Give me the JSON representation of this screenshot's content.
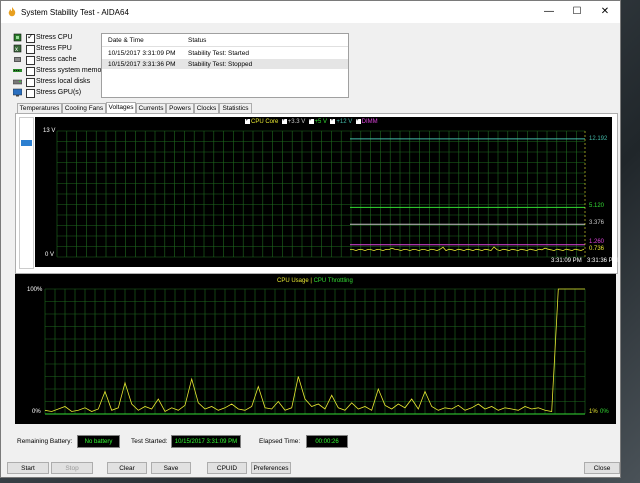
{
  "window": {
    "title": "System Stability Test - AIDA64",
    "controls": {
      "minimize": "—",
      "maximize": "☐",
      "close": "✕"
    }
  },
  "stress": {
    "items": [
      {
        "label": "Stress CPU",
        "checked": true
      },
      {
        "label": "Stress FPU",
        "checked": false
      },
      {
        "label": "Stress cache",
        "checked": false
      },
      {
        "label": "Stress system memory",
        "checked": false
      },
      {
        "label": "Stress local disks",
        "checked": false
      },
      {
        "label": "Stress GPU(s)",
        "checked": false
      }
    ]
  },
  "log": {
    "headers": {
      "date": "Date & Time",
      "status": "Status"
    },
    "rows": [
      {
        "date": "10/15/2017 3:31:09 PM",
        "status": "Stability Test: Started"
      },
      {
        "date": "10/15/2017 3:31:36 PM",
        "status": "Stability Test: Stopped"
      }
    ]
  },
  "tabs": [
    "Temperatures",
    "Cooling Fans",
    "Voltages",
    "Currents",
    "Powers",
    "Clocks",
    "Statistics"
  ],
  "active_tab": "Voltages",
  "voltage_graph": {
    "legend": [
      {
        "label": "CPU Core",
        "color": "#e8e832"
      },
      {
        "label": "+3.3 V",
        "color": "#c8c8c8"
      },
      {
        "label": "+5 V",
        "color": "#33dd33"
      },
      {
        "label": "+12 V",
        "color": "#44bbaa"
      },
      {
        "label": "DIMM",
        "color": "#dd44dd"
      }
    ],
    "y_top": "13 V",
    "y_bottom": "0 V",
    "readouts": [
      "12.192",
      "5.120",
      "3.376",
      "1.260",
      "0.736"
    ],
    "time_start": "3:31:09 PM",
    "time_end": "3:31:36 PM",
    "ymax": 13,
    "ymin": 0,
    "values": {
      "v12": 12.192,
      "v5": 5.12,
      "v33": 3.376,
      "dimm": 1.26,
      "core": 0.736
    }
  },
  "cpu_graph": {
    "legend": [
      {
        "label": "CPU Usage",
        "color": "#e8e832"
      },
      {
        "label": "|",
        "color": "#e8e832"
      },
      {
        "label": "CPU Throttling",
        "color": "#33dd33"
      }
    ],
    "y_top": "100%",
    "y_bottom": "0%",
    "readout_usage": "1%",
    "readout_throttle": "0%",
    "spikes": [
      3,
      2,
      4,
      6,
      2,
      3,
      5,
      2,
      4,
      18,
      3,
      5,
      25,
      8,
      3,
      6,
      4,
      12,
      2,
      5,
      3,
      7,
      28,
      9,
      4,
      6,
      3,
      5,
      8,
      4,
      3,
      6,
      22,
      5,
      4,
      10,
      3,
      5,
      30,
      12,
      6,
      8,
      4,
      15,
      5,
      3,
      9,
      4,
      6,
      3,
      20,
      7,
      4,
      8,
      5,
      12,
      4,
      18,
      6,
      3,
      5,
      4,
      7,
      3,
      5,
      8,
      4,
      6,
      3,
      5,
      4,
      3,
      6,
      4,
      5,
      3,
      2,
      100,
      100,
      100,
      100,
      100
    ]
  },
  "status_bar": {
    "battery_label": "Remaining Battery:",
    "battery_value": "No battery",
    "started_label": "Test Started:",
    "started_value": "10/15/2017 3:31:09 PM",
    "elapsed_label": "Elapsed Time:",
    "elapsed_value": "00:00:26"
  },
  "buttons": {
    "start": "Start",
    "stop": "Stop",
    "clear": "Clear",
    "save": "Save",
    "cpuid": "CPUID",
    "preferences": "Preferences",
    "close": "Close"
  }
}
